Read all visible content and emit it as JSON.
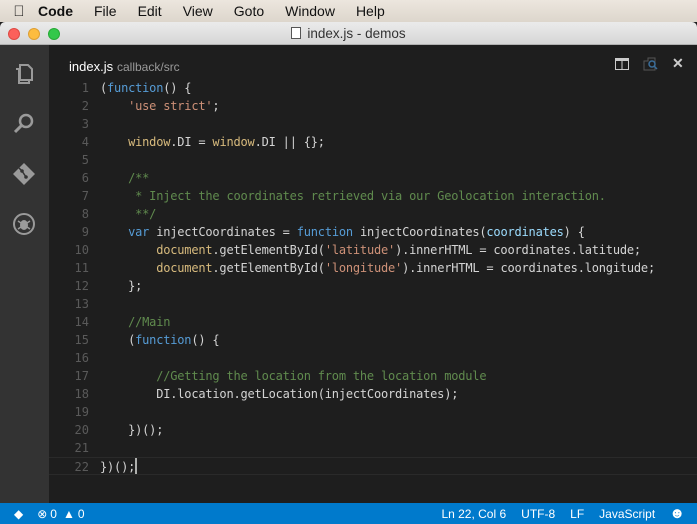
{
  "menubar": {
    "app": "Code",
    "items": [
      "File",
      "Edit",
      "View",
      "Goto",
      "Window",
      "Help"
    ]
  },
  "window": {
    "title": "index.js - demos"
  },
  "tab": {
    "name": "index.js",
    "path": "callback/src"
  },
  "editor": {
    "lines": [
      [
        [
          "tx",
          "("
        ],
        [
          "kw",
          "function"
        ],
        [
          "tx",
          "() {"
        ]
      ],
      [
        [
          "tx",
          "    "
        ],
        [
          "str",
          "'use strict'"
        ],
        [
          "tx",
          ";"
        ]
      ],
      [],
      [
        [
          "tx",
          "    "
        ],
        [
          "gl",
          "window"
        ],
        [
          "tx",
          ".DI = "
        ],
        [
          "gl",
          "window"
        ],
        [
          "tx",
          ".DI || {};"
        ]
      ],
      [],
      [
        [
          "cm",
          "    /**"
        ]
      ],
      [
        [
          "cm",
          "     * Inject the coordinates retrieved via our Geolocation interaction."
        ]
      ],
      [
        [
          "cm",
          "     **/"
        ]
      ],
      [
        [
          "tx",
          "    "
        ],
        [
          "kw",
          "var"
        ],
        [
          "tx",
          " injectCoordinates = "
        ],
        [
          "kw",
          "function"
        ],
        [
          "tx",
          " injectCoordinates("
        ],
        [
          "pm",
          "coordinates"
        ],
        [
          "tx",
          ") {"
        ]
      ],
      [
        [
          "tx",
          "        "
        ],
        [
          "gl",
          "document"
        ],
        [
          "tx",
          ".getElementById("
        ],
        [
          "str",
          "'latitude'"
        ],
        [
          "tx",
          ").innerHTML = coordinates.latitude;"
        ]
      ],
      [
        [
          "tx",
          "        "
        ],
        [
          "gl",
          "document"
        ],
        [
          "tx",
          ".getElementById("
        ],
        [
          "str",
          "'longitude'"
        ],
        [
          "tx",
          ").innerHTML = coordinates.longitude;"
        ]
      ],
      [
        [
          "tx",
          "    };"
        ]
      ],
      [],
      [
        [
          "cm",
          "    //Main"
        ]
      ],
      [
        [
          "tx",
          "    ("
        ],
        [
          "kw",
          "function"
        ],
        [
          "tx",
          "() {"
        ]
      ],
      [],
      [
        [
          "cm",
          "        //Getting the location from the location module"
        ]
      ],
      [
        [
          "tx",
          "        DI.location.getLocation(injectCoordinates);"
        ]
      ],
      [],
      [
        [
          "tx",
          "    })();"
        ]
      ],
      [],
      [
        [
          "tx",
          "})();"
        ]
      ]
    ]
  },
  "status": {
    "errors": "0",
    "warnings": "0",
    "position": "Ln 22, Col 6",
    "encoding": "UTF-8",
    "eol": "LF",
    "language": "JavaScript"
  }
}
